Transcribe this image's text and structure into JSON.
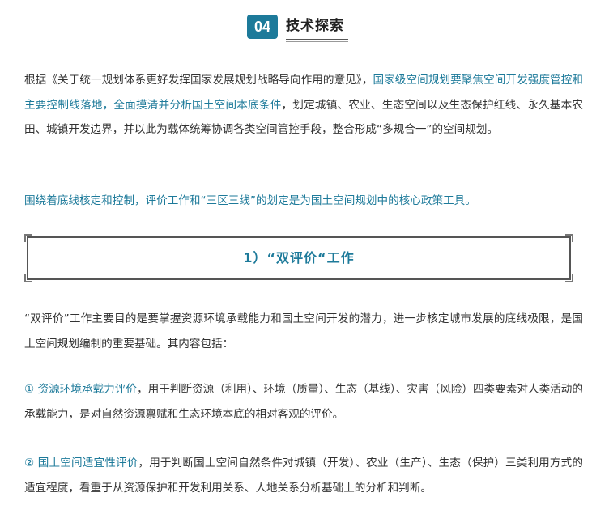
{
  "header": {
    "number": "04",
    "title": "技术探索"
  },
  "paragraph1": {
    "part1": "根据《关于统一规划体系更好发挥国家发展规划战略导向作用的意见》，",
    "highlight": "国家级空间规划要聚焦空间开发强度管控和主要控制线落地，全面摸清并分析国土空间本底条件",
    "part2": "，划定城镇、农业、生态空间以及生态保护红线、永久基本农田、城镇开发边界，并以此为载体统筹协调各类空间管控手段，整合形成“多规合一”的空间规划。"
  },
  "paragraph2": {
    "highlight": "围绕着底线核定和控制，评价工作和“三区三线”的划定是为国土空间规划中的核心政策工具。"
  },
  "subsection": {
    "title": "1）“双评价“工作"
  },
  "paragraph3": {
    "text": "“双评价”工作主要目的是要掌握资源环境承载能力和国土空间开发的潜力，进一步核定城市发展的底线极限，是国土空间规划编制的重要基础。其内容包括："
  },
  "item1": {
    "highlight": "① 资源环境承载力评价",
    "text": "，用于判断资源（利用）、环境（质量）、生态（基线）、灾害（风险）四类要素对人类活动的承载能力，是对自然资源禀赋和生态环境本底的相对客观的评价。"
  },
  "item2": {
    "highlight": " ② 国土空间适宜性评价",
    "text": "，用于判断国土空间自然条件对城镇（开发）、农业（生产）、生态（保护）三类利用方式的适宜程度，看重于从资源保护和开发利用关系、人地关系分析基础上的分析和判断。"
  },
  "colors": {
    "accent": "#1d7a9a",
    "text": "#333333"
  }
}
